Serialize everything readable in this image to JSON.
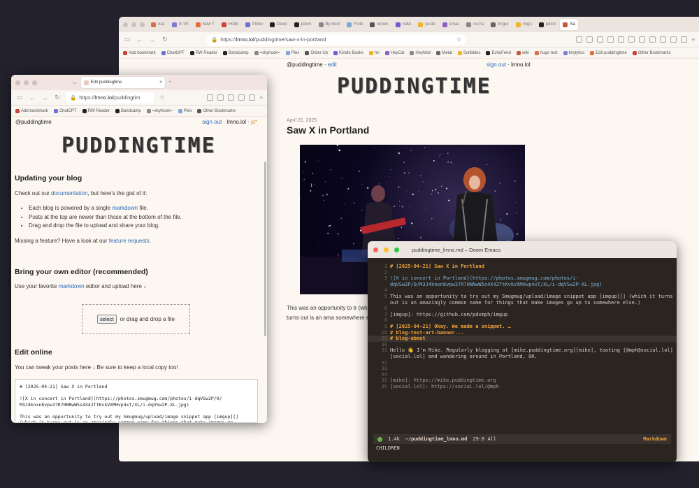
{
  "big_browser": {
    "tabs": [
      "nac",
      "In Vir",
      "New T",
      "Hotbi",
      "Pilote",
      "Devic",
      "pdxm",
      "By-hoot",
      "Follo",
      "xenon",
      "mike",
      "yesto",
      "emac",
      "ox-hu",
      "Imgur",
      "imgu",
      "pdxm",
      "Sa"
    ],
    "active_tab": "Sa",
    "url_prefix": "https://",
    "url_host": "lmno.lol",
    "url_path": "/puddingtime/saw-x-in-portland",
    "bookmarks": [
      "Add bookmark",
      "ChatGPT",
      "RW Reader",
      "Bandcamp",
      "=skyhook=",
      "Plex",
      "Order Up",
      "Kindle Books",
      "hn",
      "HeyCal",
      "HeyMail",
      "Metal",
      "Scribbles",
      "EchoFeed",
      "wiki",
      "hugo test",
      "tinylytics",
      "Edit puddingtime",
      "Other Bookmarks"
    ]
  },
  "blog_page": {
    "handle": "@puddingtime",
    "edit_link": "edit",
    "sign_out": "sign out",
    "site": "lmno.lol",
    "banner": "PUDDINGTIME",
    "date": "April 21, 2025",
    "title": "Saw X in Portland",
    "paragraph": "This was an opportunity to tr (which it turns out is an ama somewhere else.)"
  },
  "small_browser": {
    "tab_title": "Edit puddingtime",
    "url_prefix": "https://",
    "url_host": "lmno.lol",
    "url_path": "/puddingtim",
    "bookmarks": [
      "Add bookmark",
      "ChatGPT",
      "RW Reader",
      "Bandcamp",
      "=skyhook=",
      "Plex",
      "Other Bookmarks"
    ]
  },
  "edit_page": {
    "handle": "@puddingtime",
    "sign_out": "sign out",
    "site": "lmno.lol",
    "js": "js*",
    "banner": "PUDDINGTIME",
    "h_updating": "Updating your blog",
    "intro_pre": "Check out our",
    "intro_link": "documentation",
    "intro_post": ", but here's the gist of it:",
    "bullet1_pre": "Each blog is powered by a single",
    "bullet1_link": "markdown",
    "bullet1_post": "file.",
    "bullet2": "Posts at the top are newer than those at the bottom of the file.",
    "bullet3": "Drag and drop the file to upload and share your blog.",
    "missing_pre": "Missing a feature? Have a look at our",
    "missing_link": "feature requests",
    "missing_post": ".",
    "h_byo": "Bring your own editor (recommended)",
    "byo_pre": "Use your favorite",
    "byo_link": "markdown",
    "byo_post": "editor and upload here ↓",
    "select_label": "select",
    "drop_text": "or drag and drop a file",
    "h_online": "Edit online",
    "online_text": "You can tweak your posts here ↓ Be sure to keep a local copy too!",
    "editor_text": "# [2025-04-21] Saw X in Portland\n\n![X in concert in Portland](https://photos.smugmug.com/photos/i-dqVSw2P/0/\nM3J4knxn8vpw37R7HNNwW5s4X42TtKvkVXMHvp4xT/XL/i-dqVSw2P-XL.jpg)\n\nThis was an opportunity to try out my Smugmug/upload/image snippet app [imgup][]\n(which it turns out is an amazingly common name for things that make images go"
  },
  "emacs": {
    "title": "puddingtime_lmno.md – Doom Emacs",
    "lines": [
      {
        "n": "1",
        "t": "# [2025-04-21] Saw X in Portland",
        "cls": "h"
      },
      {
        "n": "2",
        "t": "",
        "cls": ""
      },
      {
        "n": "3",
        "t": "![X in concert in Portland](https://photos.smugmug.com/photos/i-dqVSw2P/0/M3J4knxn8vpw37R7HNNwW5s4X42TtKvkVXMHvp4xT/XL/i-dqVSw2P-XL.jpg)",
        "cls": "lk"
      },
      {
        "n": "4",
        "t": "",
        "cls": ""
      },
      {
        "n": "5",
        "t": "This was an opportunity to try out my Smugmug/upload/image snippet app [imgup][] (which it turns out is an amazingly common name for things that make images go up to somewhere else.)",
        "cls": ""
      },
      {
        "n": "6",
        "t": "",
        "cls": ""
      },
      {
        "n": "7",
        "t": "[imgup]: https://github.com/pdxmph/imgup",
        "cls": ""
      },
      {
        "n": "8",
        "t": "",
        "cls": ""
      },
      {
        "n": "9",
        "t": "# [2025-04-21] Okay. We made a snippet. …",
        "cls": "h"
      },
      {
        "n": "16",
        "t": "# blog-text-art-banner...",
        "cls": "h"
      },
      {
        "n": "29",
        "t": "# blog-about",
        "cls": "h"
      },
      {
        "n": "30",
        "t": "",
        "cls": ""
      },
      {
        "n": "31",
        "t": "Hello 👋 I'm Mike. Regularly blogging at [mike.puddingtime.org][mike], tooting [@mph@social.lol][social.lol] and wandering around in Portland, OR.",
        "cls": ""
      },
      {
        "n": "32",
        "t": "",
        "cls": ""
      },
      {
        "n": "33",
        "t": "",
        "cls": ""
      },
      {
        "n": "34",
        "t": "",
        "cls": ""
      },
      {
        "n": "35",
        "t": "[mike]: https://mike.puddingtime.org",
        "cls": "mu"
      },
      {
        "n": "36",
        "t": "[social.lol]: https://social.lol/@mph",
        "cls": "mu"
      }
    ],
    "current_line": "29",
    "modeline_size": "1.4k",
    "modeline_file": "~/puddingtime_lmno.md",
    "modeline_pos": "29:8 All",
    "modeline_mode": "Markdown",
    "echo": "CHILDREN"
  },
  "colors": {
    "link": "#2c6cb6",
    "heading_emacs": "#f2a33a",
    "page_bg": "#fdf7f1"
  }
}
